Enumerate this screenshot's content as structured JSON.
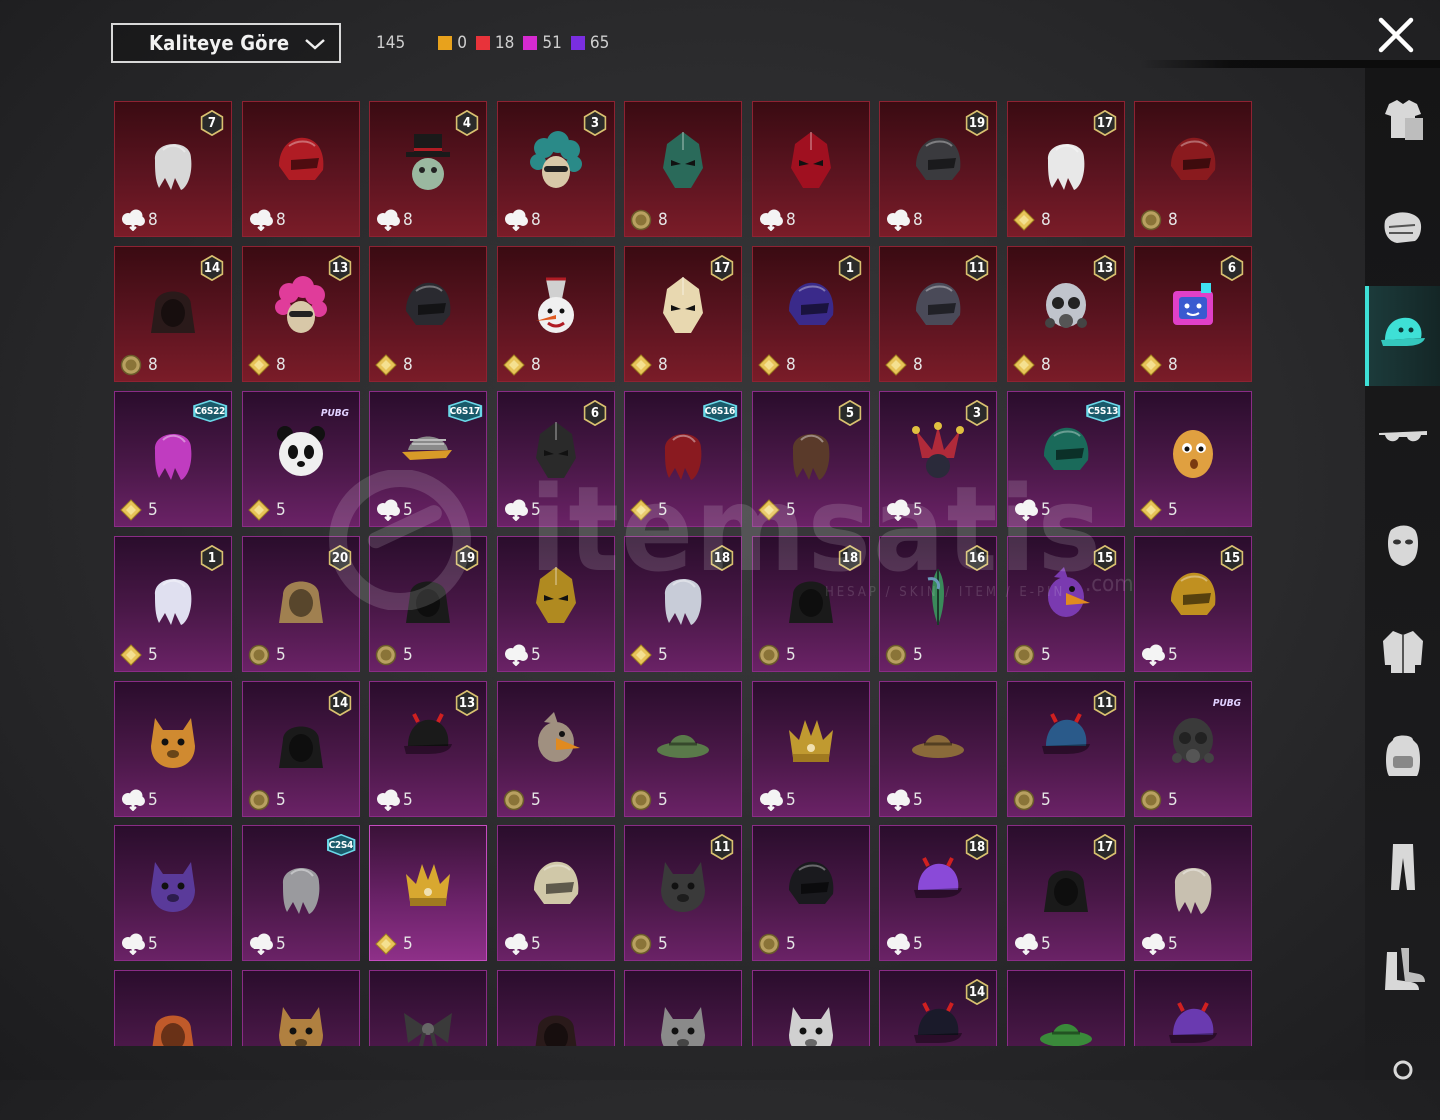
{
  "header": {
    "sort_label": "Kaliteye Göre",
    "total_count": "145",
    "quality_counts": [
      {
        "color": "#e8a21c",
        "count": "0"
      },
      {
        "color": "#e8333a",
        "count": "18"
      },
      {
        "color": "#d62ad0",
        "count": "51"
      },
      {
        "color": "#7a2ee0",
        "count": "65"
      }
    ]
  },
  "watermark": {
    "brand": "itemsatis",
    "domain": ".com",
    "tagline": "HESAP / SKIN / ITEM / E-PIN"
  },
  "sidebar": {
    "items": [
      {
        "icon": "outfit-icon"
      },
      {
        "icon": "face-icon"
      },
      {
        "icon": "cap-icon",
        "active": true
      },
      {
        "icon": "glasses-icon"
      },
      {
        "icon": "mask-icon"
      },
      {
        "icon": "jacket-icon"
      },
      {
        "icon": "backpack-icon"
      },
      {
        "icon": "pants-icon"
      },
      {
        "icon": "shoes-icon"
      },
      {
        "icon": "more-icon"
      }
    ]
  },
  "grid": {
    "rows": [
      [
        {
          "q": "red",
          "badge": "7",
          "cur": "bp",
          "n": "8",
          "art": "wig",
          "c": "#d8d8d8"
        },
        {
          "q": "red",
          "badge": "",
          "cur": "bp",
          "n": "8",
          "art": "helmet",
          "c": "#b01c24"
        },
        {
          "q": "red",
          "badge": "4",
          "cur": "bp",
          "n": "8",
          "art": "tophat",
          "c": "#1a1a1a"
        },
        {
          "q": "red",
          "badge": "3",
          "cur": "bp",
          "n": "8",
          "art": "curly",
          "c": "#2a8a88"
        },
        {
          "q": "red",
          "badge": "",
          "cur": "uc",
          "n": "8",
          "art": "mask",
          "c": "#2a6a5a"
        },
        {
          "q": "red",
          "badge": "",
          "cur": "bp",
          "n": "8",
          "art": "mask",
          "c": "#a01020"
        },
        {
          "q": "red",
          "badge": "19",
          "cur": "bp",
          "n": "8",
          "art": "helmet",
          "c": "#3a3a3e"
        },
        {
          "q": "red",
          "badge": "17",
          "cur": "ag",
          "n": "8",
          "art": "wig",
          "c": "#e8e8e8"
        },
        {
          "q": "red",
          "badge": "",
          "cur": "uc",
          "n": "8",
          "art": "helmet",
          "c": "#8a1a1e"
        }
      ],
      [
        {
          "q": "red",
          "badge": "14",
          "cur": "uc",
          "n": "8",
          "art": "hood",
          "c": "#2a1a1a"
        },
        {
          "q": "red",
          "badge": "13",
          "cur": "ag",
          "n": "8",
          "art": "curly",
          "c": "#e03c9a"
        },
        {
          "q": "red",
          "badge": "",
          "cur": "ag",
          "n": "8",
          "art": "helmet",
          "c": "#2a2a30"
        },
        {
          "q": "red",
          "badge": "",
          "cur": "ag",
          "n": "8",
          "art": "snowman",
          "c": "#f0f0f0"
        },
        {
          "q": "red",
          "badge": "17",
          "cur": "ag",
          "n": "8",
          "art": "mask",
          "c": "#e8d8b0"
        },
        {
          "q": "red",
          "badge": "1",
          "cur": "ag",
          "n": "8",
          "art": "helmet",
          "c": "#3a2a8a"
        },
        {
          "q": "red",
          "badge": "11",
          "cur": "ag",
          "n": "8",
          "art": "helmet",
          "c": "#4a4a58"
        },
        {
          "q": "red",
          "badge": "13",
          "cur": "ag",
          "n": "8",
          "art": "gasmask",
          "c": "#c0c4cc"
        },
        {
          "q": "red",
          "badge": "6",
          "cur": "ag",
          "n": "8",
          "art": "box",
          "c": "#e040c8"
        }
      ],
      [
        {
          "q": "purple",
          "badge": "C6S22",
          "cur": "ag",
          "n": "5",
          "art": "wig",
          "c": "#c03cc0"
        },
        {
          "q": "purple",
          "badge": "PUBG",
          "cur": "ag",
          "n": "5",
          "art": "panda",
          "c": "#f0f0f0"
        },
        {
          "q": "purple",
          "badge": "C6S17",
          "cur": "bp",
          "n": "5",
          "art": "visor",
          "c": "#d89a28"
        },
        {
          "q": "purple",
          "badge": "6",
          "cur": "bp",
          "n": "5",
          "art": "mask",
          "c": "#2a2a2a"
        },
        {
          "q": "purple",
          "badge": "C6S16",
          "cur": "ag",
          "n": "5",
          "art": "wig",
          "c": "#8a1a20"
        },
        {
          "q": "purple",
          "badge": "5",
          "cur": "ag",
          "n": "5",
          "art": "wig",
          "c": "#5a3a2a"
        },
        {
          "q": "purple",
          "badge": "3",
          "cur": "bp",
          "n": "5",
          "art": "jester",
          "c": "#b02a3a"
        },
        {
          "q": "purple",
          "badge": "C5S13",
          "cur": "bp",
          "n": "5",
          "art": "helmet",
          "c": "#1a6a5a"
        },
        {
          "q": "purple",
          "badge": "",
          "cur": "ag",
          "n": "5",
          "art": "potato",
          "c": "#e0a040"
        }
      ],
      [
        {
          "q": "purple",
          "badge": "1",
          "cur": "ag",
          "n": "5",
          "art": "wig",
          "c": "#e0e0f0"
        },
        {
          "q": "purple",
          "badge": "20",
          "cur": "uc",
          "n": "5",
          "art": "hood",
          "c": "#a08050"
        },
        {
          "q": "purple",
          "badge": "19",
          "cur": "uc",
          "n": "5",
          "art": "hood",
          "c": "#1a1a1a"
        },
        {
          "q": "purple",
          "badge": "",
          "cur": "bp",
          "n": "5",
          "art": "mask",
          "c": "#b08a20"
        },
        {
          "q": "purple",
          "badge": "18",
          "cur": "ag",
          "n": "5",
          "art": "wig",
          "c": "#c8ccd8"
        },
        {
          "q": "purple",
          "badge": "18",
          "cur": "uc",
          "n": "5",
          "art": "hood",
          "c": "#1a1a1a"
        },
        {
          "q": "purple",
          "badge": "16",
          "cur": "uc",
          "n": "5",
          "art": "feather",
          "c": "#3a8a5a"
        },
        {
          "q": "purple",
          "badge": "15",
          "cur": "uc",
          "n": "5",
          "art": "bird",
          "c": "#7a3ab0"
        },
        {
          "q": "purple",
          "badge": "15",
          "cur": "bp",
          "n": "5",
          "art": "helmet",
          "c": "#c09020"
        }
      ],
      [
        {
          "q": "purple",
          "badge": "",
          "cur": "bp",
          "n": "5",
          "art": "animal",
          "c": "#d08a30"
        },
        {
          "q": "purple",
          "badge": "14",
          "cur": "uc",
          "n": "5",
          "art": "hood",
          "c": "#1a1a1a"
        },
        {
          "q": "purple",
          "badge": "13",
          "cur": "bp",
          "n": "5",
          "art": "cap",
          "c": "#1a1a1a"
        },
        {
          "q": "purple",
          "badge": "",
          "cur": "uc",
          "n": "5",
          "art": "bird",
          "c": "#a09080"
        },
        {
          "q": "purple",
          "badge": "",
          "cur": "uc",
          "n": "5",
          "art": "hat",
          "c": "#5a7a4a"
        },
        {
          "q": "purple",
          "badge": "",
          "cur": "bp",
          "n": "5",
          "art": "crown",
          "c": "#c09a30"
        },
        {
          "q": "purple",
          "badge": "",
          "cur": "bp",
          "n": "5",
          "art": "hat",
          "c": "#8a6a3a"
        },
        {
          "q": "purple",
          "badge": "11",
          "cur": "uc",
          "n": "5",
          "art": "cap",
          "c": "#2a5a8a"
        },
        {
          "q": "purple",
          "badge": "PUBG",
          "cur": "uc",
          "n": "5",
          "art": "gasmask",
          "c": "#3a3a3a"
        }
      ],
      [
        {
          "q": "purple",
          "badge": "",
          "cur": "bp",
          "n": "5",
          "art": "animal",
          "c": "#5a3a9a"
        },
        {
          "q": "purple",
          "badge": "C2S4",
          "cur": "bp",
          "n": "5",
          "art": "wig",
          "c": "#9a9a9e"
        },
        {
          "q": "sel",
          "badge": "",
          "cur": "ag",
          "n": "5",
          "art": "crown",
          "c": "#d8a830"
        },
        {
          "q": "purple",
          "badge": "",
          "cur": "bp",
          "n": "5",
          "art": "helmet",
          "c": "#d0c8a8"
        },
        {
          "q": "purple",
          "badge": "11",
          "cur": "uc",
          "n": "5",
          "art": "animal",
          "c": "#3a3a3a"
        },
        {
          "q": "purple",
          "badge": "",
          "cur": "uc",
          "n": "5",
          "art": "helmet",
          "c": "#1a1a1e"
        },
        {
          "q": "purple",
          "badge": "18",
          "cur": "bp",
          "n": "5",
          "art": "cap",
          "c": "#8a4ad8"
        },
        {
          "q": "purple",
          "badge": "17",
          "cur": "bp",
          "n": "5",
          "art": "hood",
          "c": "#1a1a1a"
        },
        {
          "q": "purple",
          "badge": "",
          "cur": "bp",
          "n": "5",
          "art": "wig",
          "c": "#c8c0b0"
        }
      ],
      [
        {
          "q": "purple",
          "badge": "",
          "cur": "bp",
          "n": "",
          "art": "hood",
          "c": "#c05a2a"
        },
        {
          "q": "purple",
          "badge": "",
          "cur": "bp",
          "n": "",
          "art": "animal",
          "c": "#b08040"
        },
        {
          "q": "purple",
          "badge": "",
          "cur": "bp",
          "n": "",
          "art": "bow",
          "c": "#3a3a3a"
        },
        {
          "q": "purple",
          "badge": "",
          "cur": "bp",
          "n": "",
          "art": "hood",
          "c": "#2a1a1a"
        },
        {
          "q": "purple",
          "badge": "",
          "cur": "bp",
          "n": "",
          "art": "animal",
          "c": "#8a8a8a"
        },
        {
          "q": "purple",
          "badge": "",
          "cur": "bp",
          "n": "",
          "art": "animal",
          "c": "#d0d0d0"
        },
        {
          "q": "purple",
          "badge": "14",
          "cur": "bp",
          "n": "",
          "art": "cap",
          "c": "#1a1a2a"
        },
        {
          "q": "purple",
          "badge": "",
          "cur": "bp",
          "n": "",
          "art": "hat",
          "c": "#3a8a3a"
        },
        {
          "q": "purple",
          "badge": "",
          "cur": "bp",
          "n": "",
          "art": "cap",
          "c": "#6a3ab0"
        }
      ]
    ]
  }
}
